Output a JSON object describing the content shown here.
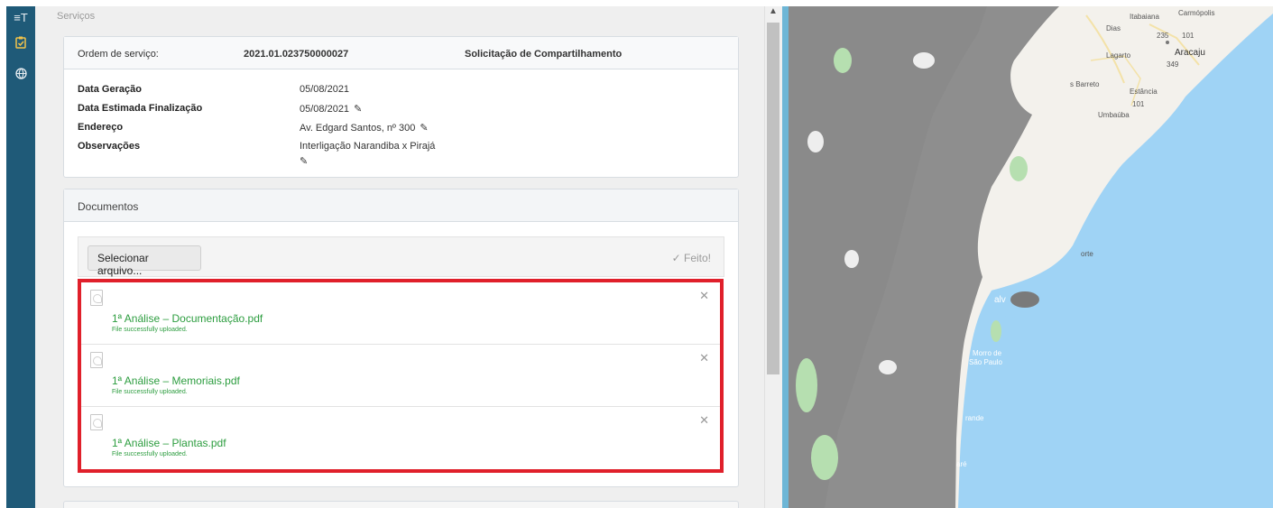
{
  "breadcrumb": "Serviços",
  "rail": {
    "icons": [
      "text-icon",
      "clipboard-check-icon",
      "globe-icon"
    ]
  },
  "ordem": {
    "label": "Ordem de serviço:",
    "number": "2021.01.023750000027",
    "type": "Solicitação de Compartilhamento",
    "fields": [
      {
        "key": "Data Geração",
        "value": "05/08/2021"
      },
      {
        "key": "Data Estimada Finalização",
        "value": "05/08/2021"
      },
      {
        "key": "Endereço",
        "value": "Av. Edgard Santos, nº 300"
      },
      {
        "key": "Observações",
        "value": "Interligação Narandiba x Pirajá"
      }
    ]
  },
  "documentos": {
    "title": "Documentos",
    "select_label": "Selecionar arquivo...",
    "done_label": "✓ Feito!",
    "files": [
      {
        "name": "1ª Análise – Documentação.pdf",
        "status": "File successfully uploaded."
      },
      {
        "name": "1ª Análise – Memoriais.pdf",
        "status": "File successfully uploaded."
      },
      {
        "name": "1ª Análise – Plantas.pdf",
        "status": "File successfully uploaded."
      }
    ]
  },
  "map": {
    "labels": [
      "Itabaiana",
      "Carmópolis",
      "Dias",
      "235",
      "101",
      "Lagarto",
      "Aracaju",
      "349",
      "s Barreto",
      "Estância",
      "101",
      "Umbaúba",
      "orte",
      "alv",
      "Morro de",
      "São Paulo",
      "rande",
      "aré"
    ],
    "colors": {
      "sea": "#9fd3f5",
      "land": "#8e8e8e",
      "green": "#b6dfb0",
      "road": "#f3e2a8"
    }
  }
}
